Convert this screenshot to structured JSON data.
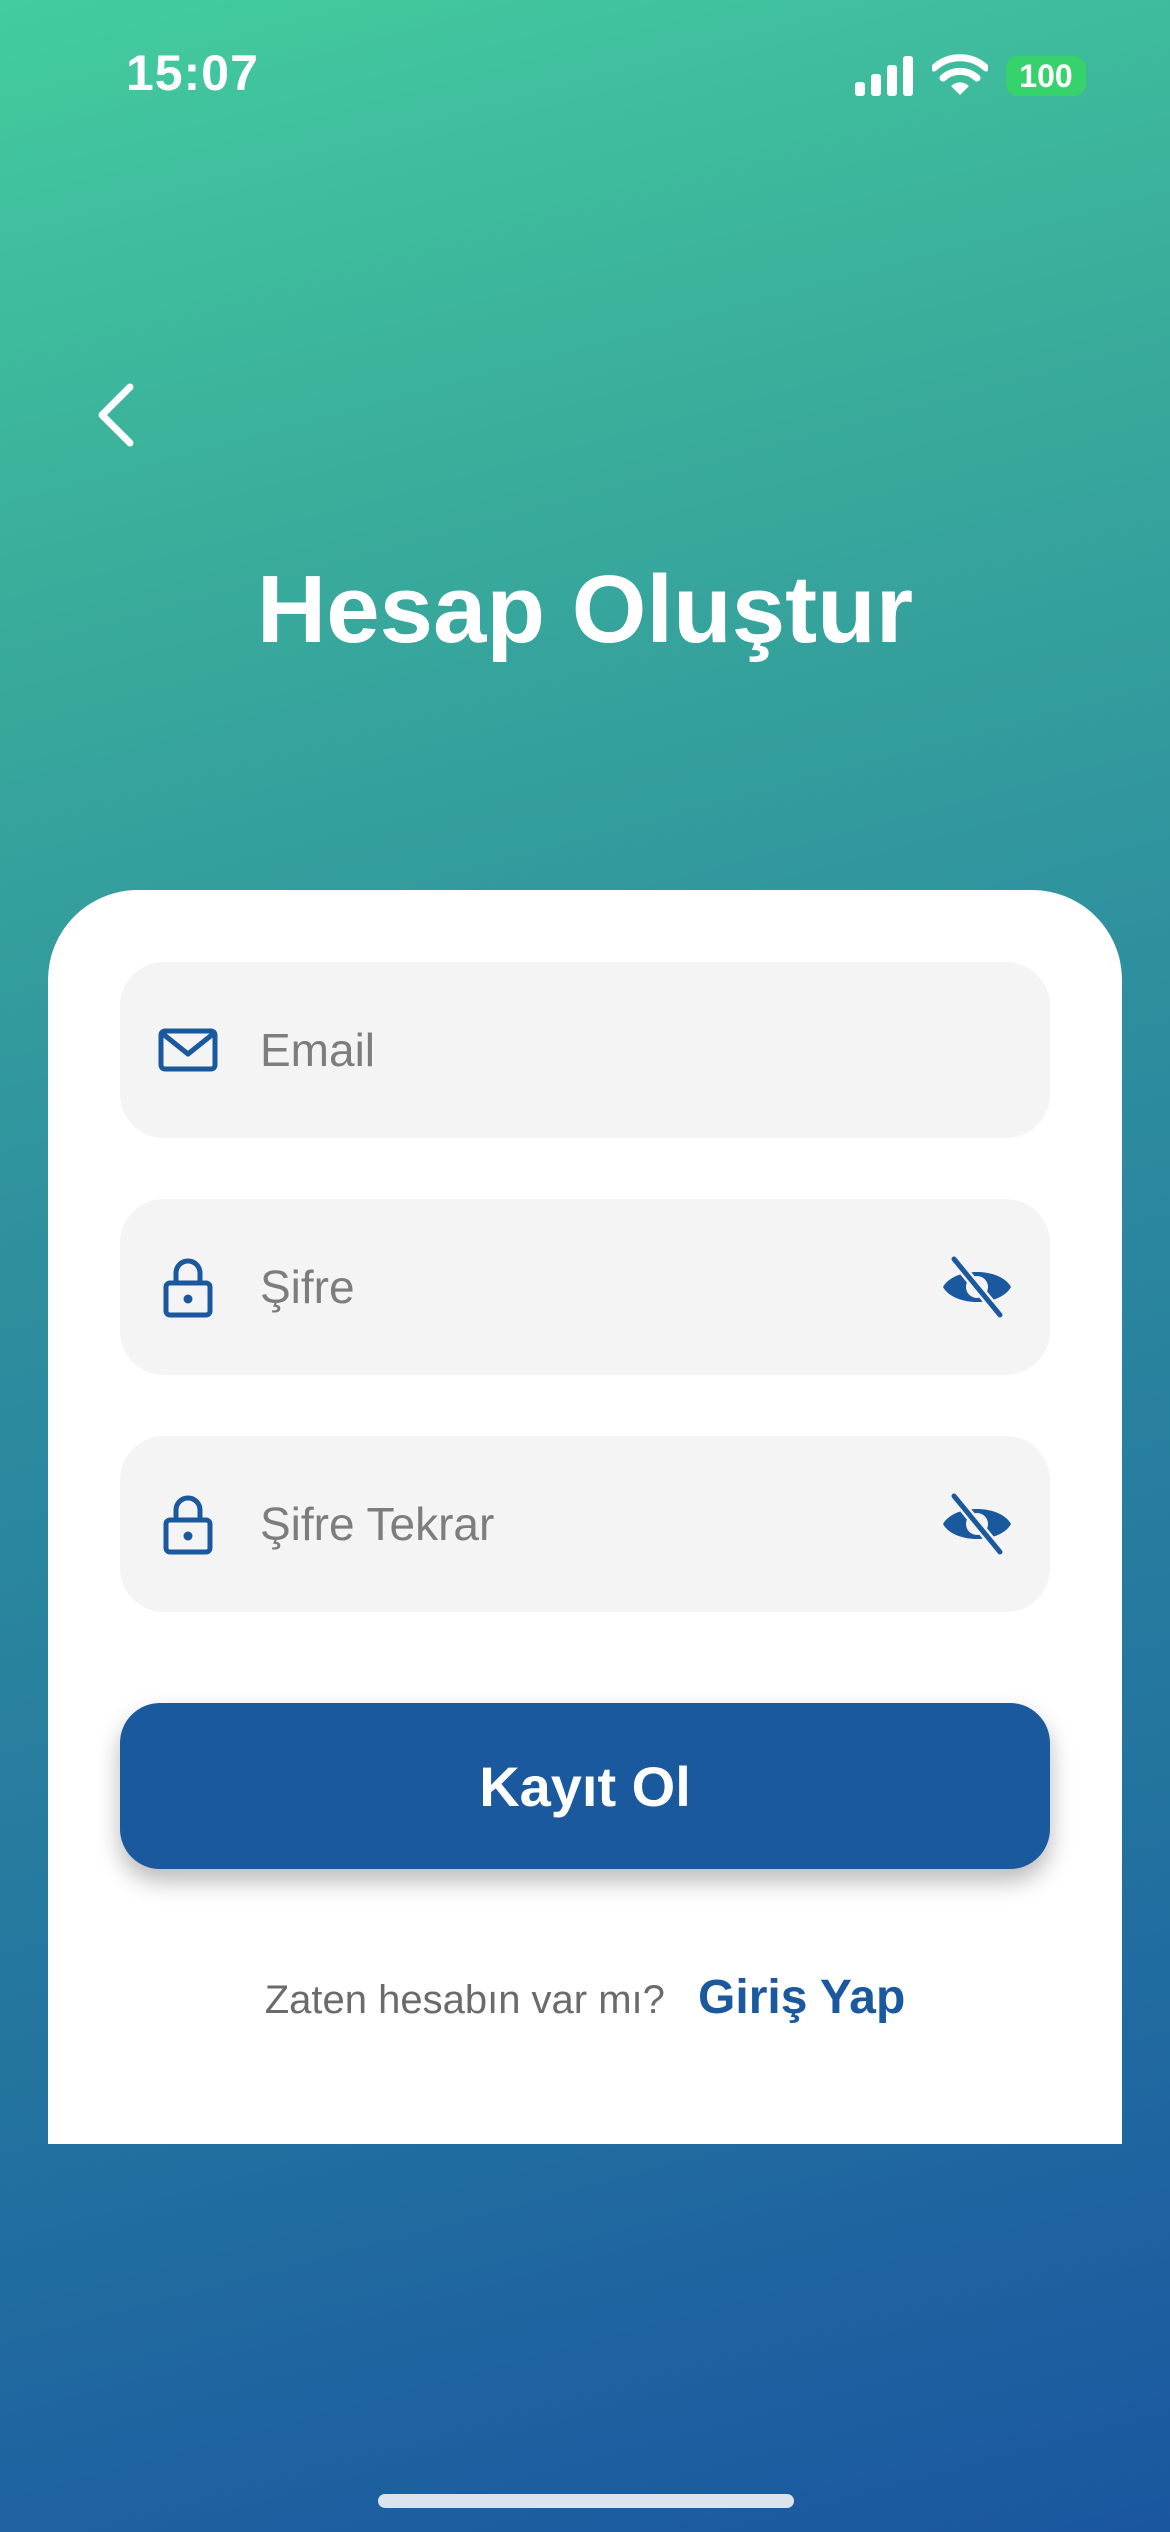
{
  "status_bar": {
    "time": "15:07",
    "battery": "100",
    "battery_color": "#36d26b"
  },
  "nav": {
    "back_icon": "chevron-left-icon"
  },
  "header": {
    "title": "Hesap Oluştur"
  },
  "form": {
    "email": {
      "placeholder": "Email",
      "value": "",
      "icon": "mail-icon"
    },
    "password": {
      "placeholder": "Şifre",
      "value": "",
      "icon": "lock-icon",
      "toggle_icon": "eye-off-icon"
    },
    "password_repeat": {
      "placeholder": "Şifre Tekrar",
      "value": "",
      "icon": "lock-icon",
      "toggle_icon": "eye-off-icon"
    },
    "submit_label": "Kayıt Ol"
  },
  "footer": {
    "question": "Zaten hesabın var mı?",
    "login_label": "Giriş Yap"
  },
  "colors": {
    "primary": "#1b599f",
    "gradient_top": "#43cc9f",
    "gradient_bottom": "#1a56a0",
    "field_bg": "#f4f4f5"
  }
}
